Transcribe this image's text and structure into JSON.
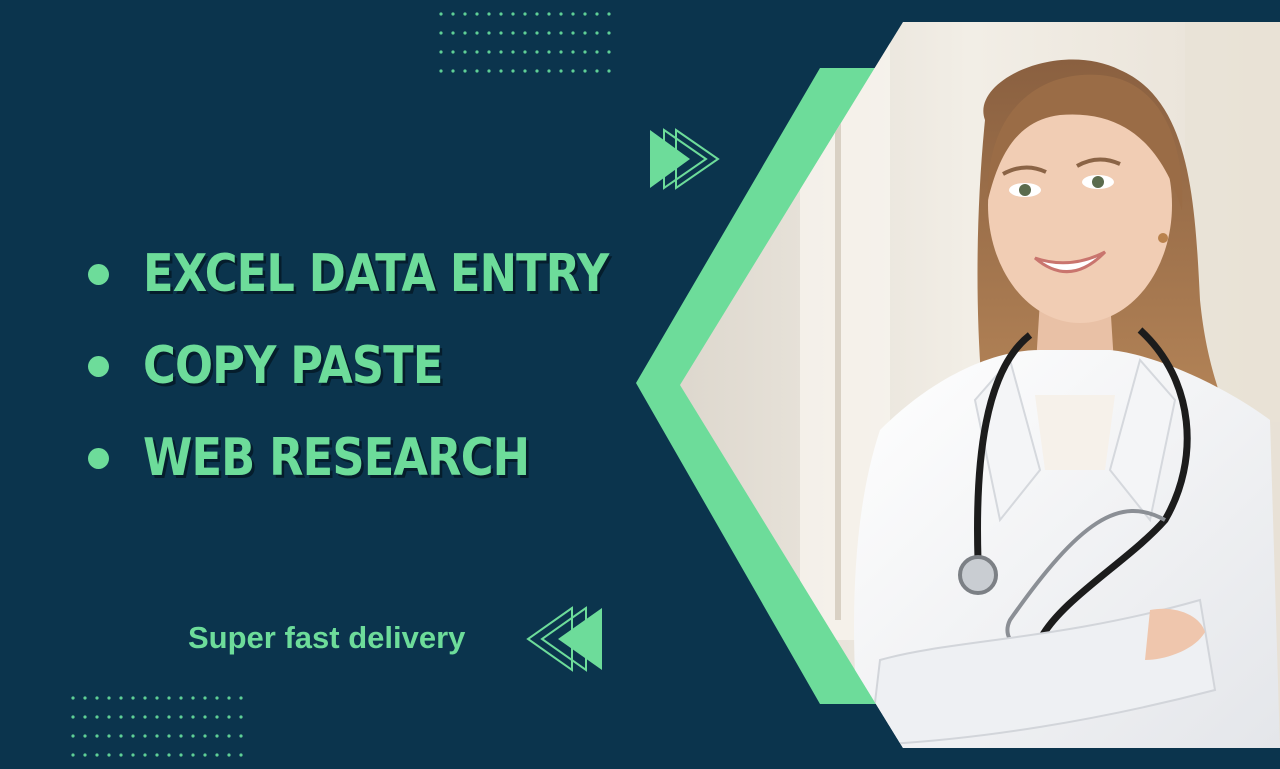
{
  "services": [
    {
      "label": "EXCEL DATA ENTRY"
    },
    {
      "label": "COPY PASTE"
    },
    {
      "label": "WEB RESEARCH"
    }
  ],
  "tagline": "Super fast delivery",
  "colors": {
    "background": "#0b344d",
    "accent": "#6ddc9a",
    "text_shadow": "#051d2c"
  },
  "icons": {
    "top_arrows": "double-chevron-right-icon",
    "bottom_arrows": "double-chevron-left-icon"
  },
  "photo": {
    "subject": "smiling doctor in white coat with stethoscope"
  }
}
